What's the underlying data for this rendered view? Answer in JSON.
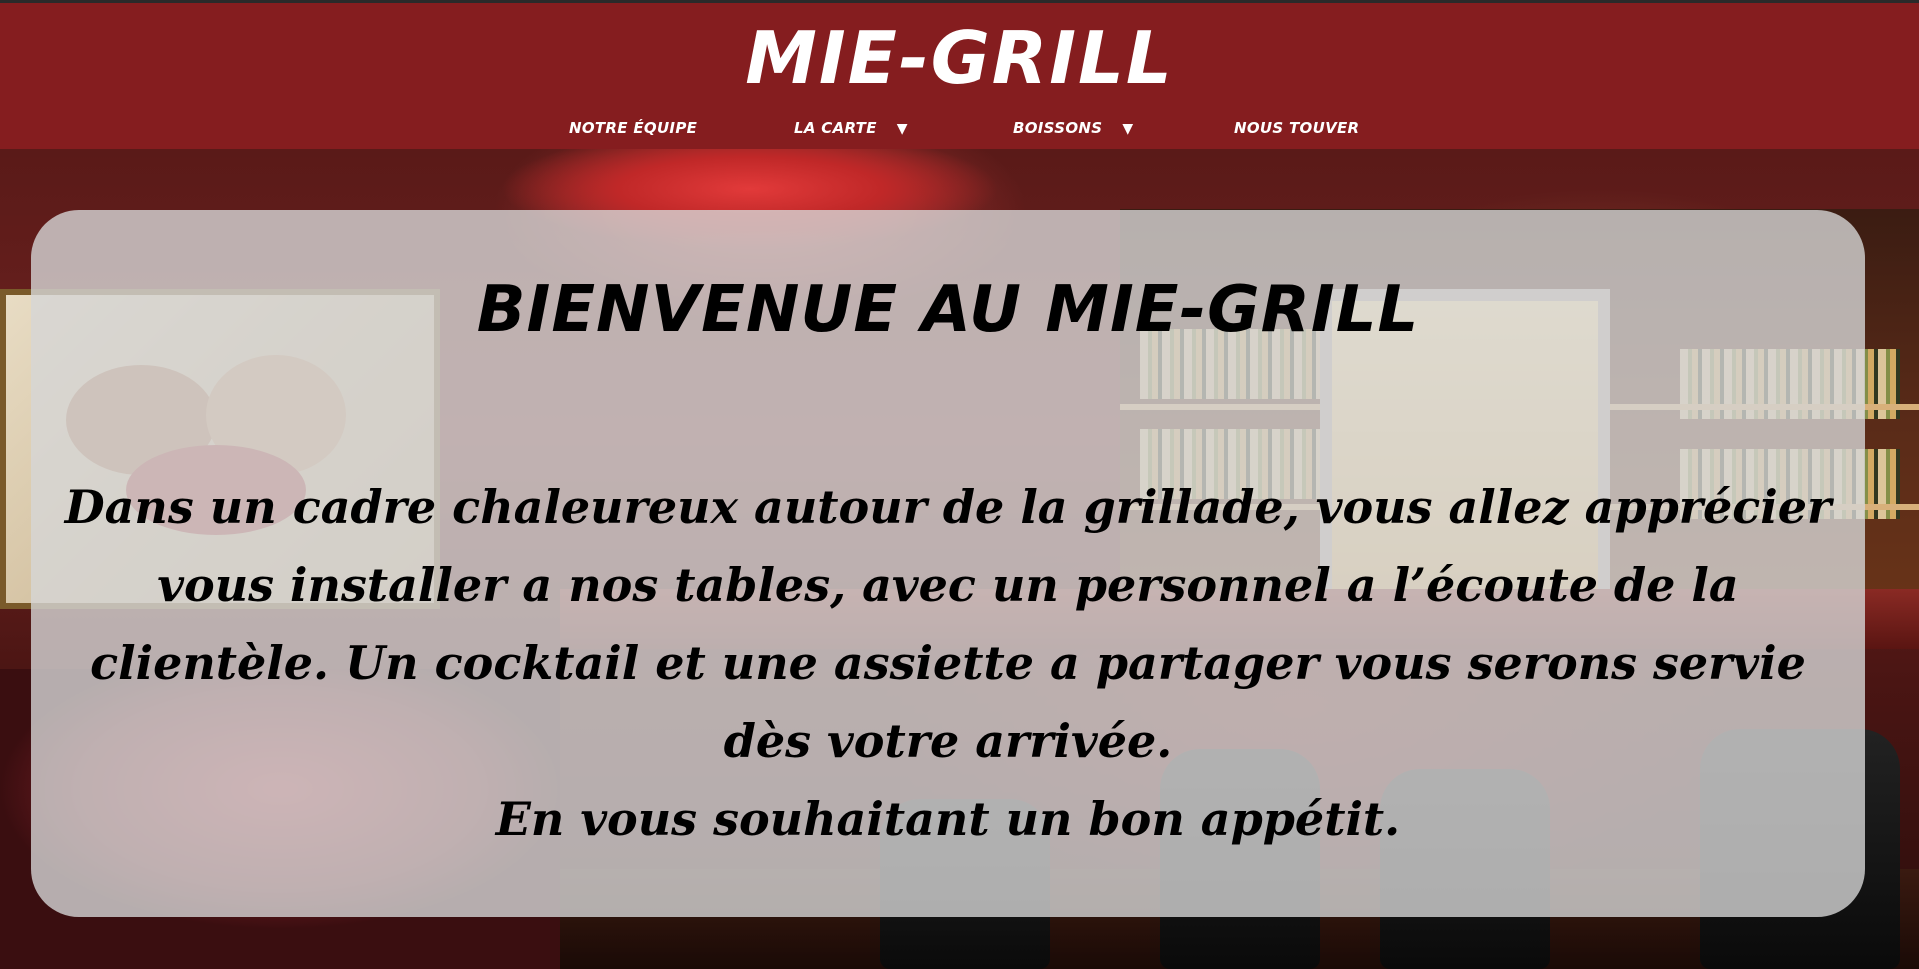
{
  "header": {
    "brand": "MIE-GRILL",
    "background_color": "#851d1f",
    "nav": [
      {
        "label": "NOTRE ÉQUIPE",
        "has_dropdown": false
      },
      {
        "label": "LA CARTE",
        "has_dropdown": true,
        "caret": "▼"
      },
      {
        "label": "BOISSONS",
        "has_dropdown": true,
        "caret": "▼"
      },
      {
        "label": "NOUS TOUVER",
        "has_dropdown": false
      }
    ]
  },
  "welcome": {
    "title": "BIENVENUE AU MIE-GRILL",
    "lines": [
      "Dans un cadre chaleureux autour de la grillade, vous allez apprécier",
      "vous installer a nos tables, avec un personnel a l’écoute de la",
      "clientèle. Un cocktail et une assiette a partager vous serons servie",
      "dès votre arrivée.",
      "En vous souhaitant un bon appétit."
    ]
  }
}
